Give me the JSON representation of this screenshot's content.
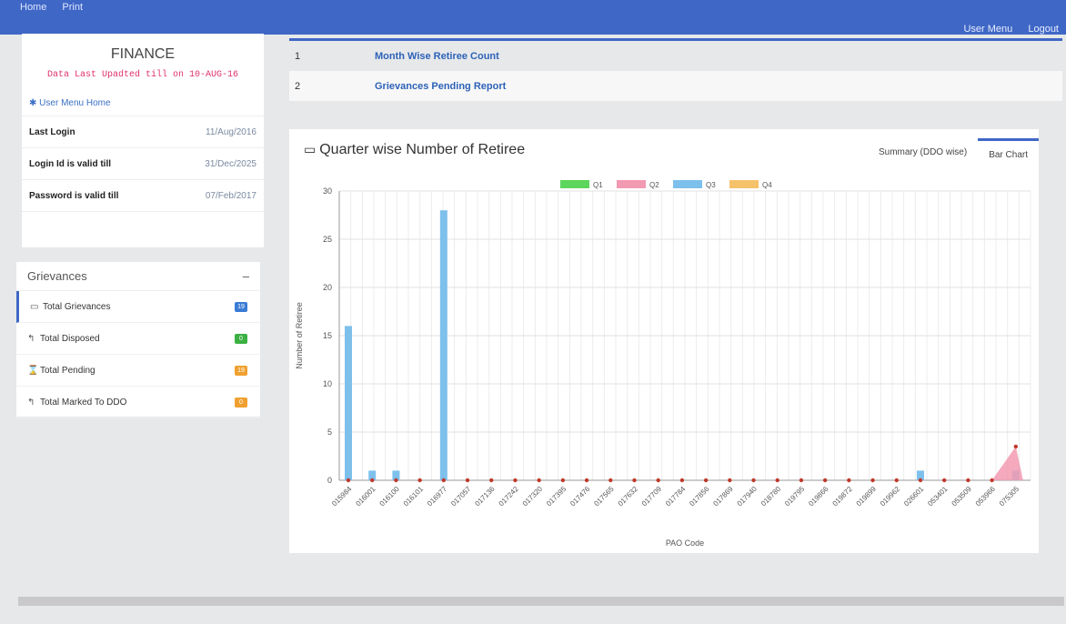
{
  "topbar": {
    "nav": [
      "Home",
      "Print"
    ],
    "user_menu": "User Menu",
    "logout": "Logout"
  },
  "finance": {
    "title": "FINANCE",
    "updated": "Data Last Upadted till on 10-AUG-16",
    "menu_home": "User Menu Home",
    "rows": [
      {
        "label": "Last Login",
        "value": "11/Aug/2016"
      },
      {
        "label": "Login Id is valid till",
        "value": "31/Dec/2025"
      },
      {
        "label": "Password is valid till",
        "value": "07/Feb/2017"
      }
    ]
  },
  "grievances": {
    "title": "Grievances",
    "collapse": "–",
    "items": [
      {
        "label": "Total Grievances",
        "badge": "19",
        "color": "#3a7bd5",
        "icon": "inbox-icon"
      },
      {
        "label": "Total Disposed",
        "badge": "0",
        "color": "#3cb043",
        "icon": "reply-icon"
      },
      {
        "label": "Total Pending",
        "badge": "19",
        "color": "#f0a030",
        "icon": "hourglass-icon"
      },
      {
        "label": "Total Marked To DDO",
        "badge": "0",
        "color": "#f0a030",
        "icon": "reply-icon"
      }
    ]
  },
  "reports": [
    {
      "num": "1",
      "label": "Month Wise Retiree Count"
    },
    {
      "num": "2",
      "label": "Grievances Pending Report"
    }
  ],
  "chart_panel": {
    "title": "Quarter wise Number of Retiree",
    "tabs": [
      "Summary (DDO wise)",
      "Bar Chart"
    ]
  },
  "chart_data": {
    "type": "bar",
    "xlabel": "PAO Code",
    "ylabel": "Number of Retiree",
    "ylim": [
      0,
      30
    ],
    "yticks": [
      0,
      5,
      10,
      15,
      20,
      25,
      30
    ],
    "categories": [
      "015984",
      "016001",
      "016100",
      "016101",
      "016977",
      "017057",
      "017136",
      "017242",
      "017320",
      "017395",
      "017476",
      "017565",
      "017632",
      "017709",
      "017784",
      "017856",
      "017869",
      "017940",
      "018780",
      "019795",
      "019866",
      "019872",
      "019899",
      "019962",
      "026601",
      "053401",
      "053509",
      "053966",
      "075305"
    ],
    "legend": "top-center",
    "grid": true,
    "series": [
      {
        "name": "Q1",
        "color": "#5cd65c",
        "values": [
          0,
          0,
          0,
          0,
          0,
          0,
          0,
          0,
          0,
          0,
          0,
          0,
          0,
          0,
          0,
          0,
          0,
          0,
          0,
          0,
          0,
          0,
          0,
          0,
          0,
          0,
          0,
          0,
          0
        ]
      },
      {
        "name": "Q2",
        "color": "#f29ab2",
        "values": [
          0,
          0,
          0,
          0,
          0,
          0,
          0,
          0,
          0,
          0,
          0,
          0,
          0,
          0,
          0,
          0,
          0,
          0,
          0,
          0,
          0,
          0,
          0,
          0,
          0,
          0,
          0,
          0,
          3.5
        ]
      },
      {
        "name": "Q3",
        "color": "#7ec0ec",
        "values": [
          16,
          1,
          1,
          0,
          28,
          0,
          0,
          0,
          0,
          0,
          0,
          0,
          0,
          0,
          0,
          0,
          0,
          0,
          0,
          0,
          0,
          0,
          0,
          0,
          1,
          0,
          0,
          0,
          1
        ]
      },
      {
        "name": "Q4",
        "color": "#f5c26b",
        "values": [
          0,
          0,
          0,
          0,
          0,
          0,
          0,
          0,
          0,
          0,
          0,
          0,
          0,
          0,
          0,
          0,
          0,
          0,
          0,
          0,
          0,
          0,
          0,
          0,
          0,
          0,
          0,
          0,
          0
        ]
      }
    ]
  }
}
